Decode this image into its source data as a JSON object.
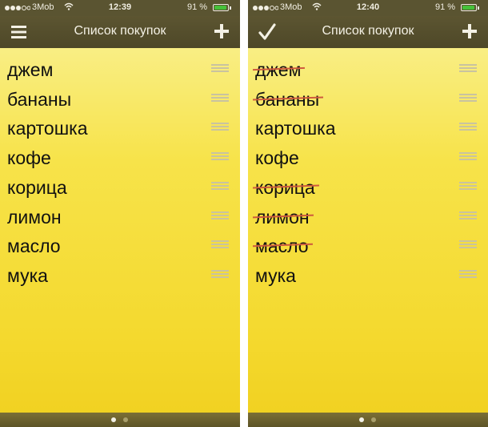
{
  "screens": [
    {
      "status": {
        "carrier": "3Mob",
        "time": "12:39",
        "battery": "91 %",
        "battery_level": 0.91
      },
      "nav": {
        "title": "Список покупок",
        "left_icon": "hamburger-menu-icon",
        "right_icon": "plus-icon"
      },
      "items": [
        {
          "label": "джем",
          "crossed": false
        },
        {
          "label": "бананы",
          "crossed": false
        },
        {
          "label": "картошка",
          "crossed": false
        },
        {
          "label": "кофе",
          "crossed": false
        },
        {
          "label": "корица",
          "crossed": false
        },
        {
          "label": "лимон",
          "crossed": false
        },
        {
          "label": "масло",
          "crossed": false
        },
        {
          "label": "мука",
          "crossed": false
        }
      ],
      "page_indicator": {
        "pages": 2,
        "current": 1
      }
    },
    {
      "status": {
        "carrier": "3Mob",
        "time": "12:40",
        "battery": "91 %",
        "battery_level": 0.91
      },
      "nav": {
        "title": "Список покупок",
        "left_icon": "checkmark-icon",
        "right_icon": "plus-icon"
      },
      "items": [
        {
          "label": "джем",
          "crossed": true
        },
        {
          "label": "бананы",
          "crossed": true
        },
        {
          "label": "картошка",
          "crossed": false
        },
        {
          "label": "кофе",
          "crossed": false
        },
        {
          "label": "корица",
          "crossed": true
        },
        {
          "label": "лимон",
          "crossed": true
        },
        {
          "label": "масло",
          "crossed": true
        },
        {
          "label": "мука",
          "crossed": false
        }
      ],
      "page_indicator": {
        "pages": 2,
        "current": 1
      }
    }
  ],
  "colors": {
    "bar": "#5a5431",
    "strike": "#ce5a3d",
    "battery": "#46c13a",
    "dot_active": "#f2f0e6",
    "dot_inactive": "#a99f6b"
  }
}
